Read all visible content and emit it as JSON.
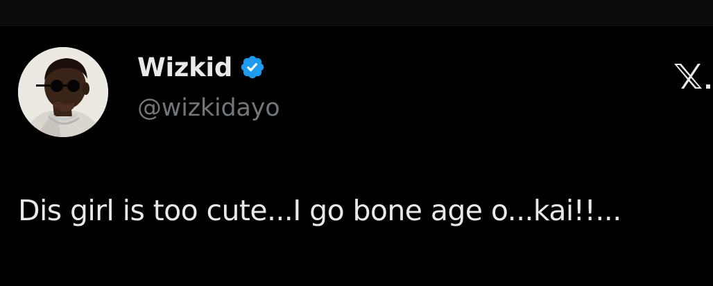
{
  "tweet": {
    "author": {
      "display_name": "Wizkid",
      "handle": "@wizkidayo",
      "verified": true,
      "avatar_icon": "profile-photo"
    },
    "text": "Dis girl is too cute...I go bone age o...kai!!...",
    "platform_icon": "x-logo-icon"
  },
  "colors": {
    "background": "#000000",
    "text_primary": "#e7e9ea",
    "text_secondary": "#71767b",
    "verified_badge": "#1d9bf0"
  }
}
